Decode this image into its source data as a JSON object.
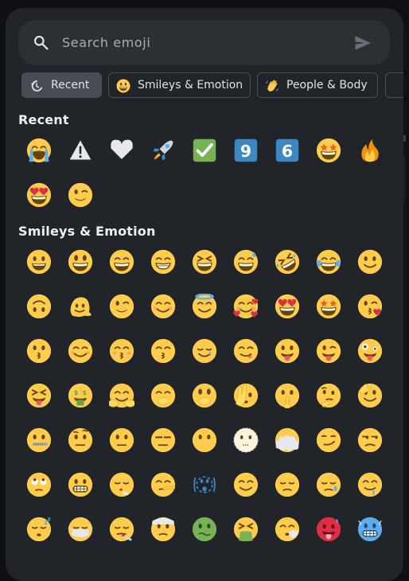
{
  "search": {
    "placeholder": "Search emoji",
    "value": ""
  },
  "tabs": [
    {
      "label": "Recent",
      "icon": "history-icon",
      "active": true
    },
    {
      "label": "Smileys & Emotion",
      "icon": "grinning-face",
      "active": false
    },
    {
      "label": "People & Body",
      "icon": "waving-hand",
      "active": false
    },
    {
      "label": "",
      "icon": "next-category",
      "active": false
    }
  ],
  "sections": [
    {
      "title": "Recent",
      "emojis": [
        "loudly-crying-face",
        "warning-sign",
        "white-heart",
        "rocket",
        "check-mark-button",
        "keycap-9",
        "keycap-6",
        "star-struck",
        "fire",
        "smiling-face-with-heart-eyes",
        "winking-face"
      ]
    },
    {
      "title": "Smileys & Emotion",
      "emojis": [
        "grinning-face",
        "grinning-face-with-big-eyes",
        "grinning-face-with-smiling-eyes",
        "beaming-face-with-smiling-eyes",
        "grinning-squinting-face",
        "grinning-face-with-sweat",
        "rolling-on-the-floor-laughing",
        "face-with-tears-of-joy",
        "slightly-smiling-face",
        "upside-down-face",
        "melting-face",
        "winking-face",
        "smiling-face-with-smiling-eyes",
        "smiling-face-with-halo",
        "smiling-face-with-hearts",
        "smiling-face-with-heart-eyes",
        "star-struck",
        "face-blowing-a-kiss",
        "kissing-face",
        "smiling-face",
        "kissing-face-with-closed-eyes",
        "kissing-face-with-smiling-eyes",
        "smiling-face-with-tear",
        "face-savoring-food",
        "face-with-tongue",
        "winking-face-with-tongue",
        "zany-face",
        "squinting-face-with-tongue",
        "money-mouth-face",
        "smiling-face-with-open-hands",
        "face-with-hand-over-mouth",
        "face-with-open-eyes-and-hand-over-mouth",
        "face-with-peeking-eye",
        "shushing-face",
        "thinking-face",
        "saluting-face",
        "zipper-mouth-face",
        "face-with-raised-eyebrow",
        "neutral-face",
        "expressionless-face",
        "face-without-mouth",
        "dotted-line-face",
        "face-in-clouds",
        "smirking-face",
        "unamused-face",
        "face-with-rolling-eyes",
        "grimacing-face",
        "face-exhaling",
        "lying-face",
        "shaking-face",
        "relieved-face",
        "pensive-face",
        "sleepy-face",
        "drooling-face",
        "sleeping-face",
        "face-with-medical-mask",
        "face-with-thermometer",
        "face-with-head-bandage",
        "nauseated-face",
        "face-vomiting",
        "sneezing-face",
        "hot-face",
        "cold-face"
      ]
    }
  ],
  "colors": {
    "panel": "#212428",
    "search_bg": "#2c2f34",
    "tab_active": "#474c55",
    "tab_border": "#4a4f57",
    "text": "#eef0f2",
    "face": "#ffcc4d",
    "face_feature": "#664500"
  }
}
